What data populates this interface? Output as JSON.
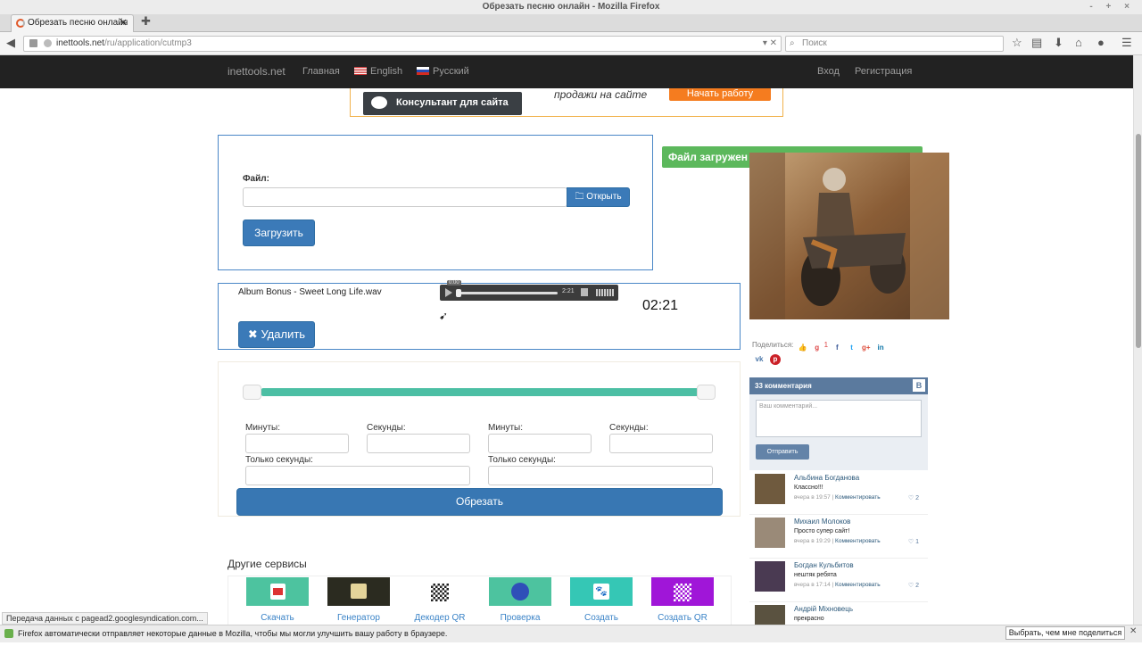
{
  "window": {
    "title": "Обрезать песню онлайн - Mozilla Firefox",
    "controls": "- + ×"
  },
  "tab": {
    "title": "Обрезать песню онлайн",
    "close": "✕",
    "new_tab": "✚"
  },
  "navbar": {
    "url_host": "inettools.net",
    "url_path": "/ru/application/cutmp3",
    "url_right": "▾ ✕",
    "search_placeholder": "Поиск"
  },
  "site_nav": {
    "brand": "inettools.net",
    "home": "Главная",
    "english": "English",
    "russian": "Русский",
    "login": "Вход",
    "register": "Регистрация"
  },
  "ad": {
    "consultant": "Консультант для сайта",
    "tagline": "продажи на сайте",
    "cta": "Начать работу"
  },
  "upload": {
    "file_label": "Файл:",
    "open_btn": "Открыть",
    "upload_btn": "Загрузить"
  },
  "track": {
    "name": "Album Bonus - Sweet Long Life.wav",
    "player_time": "2:21",
    "player_tip": "0:00",
    "duration": "02:21",
    "delete_btn": "Удалить"
  },
  "trim": {
    "start_min_label": "Минуты:",
    "start_sec_label": "Секунды:",
    "end_min_label": "Минуты:",
    "end_sec_label": "Секунды:",
    "start_only_sec": "Только секунды:",
    "end_only_sec": "Только секунды:",
    "cut_btn": "Обрезать"
  },
  "side": {
    "file_loaded": "Файл загружен",
    "share_label": "Поделиться:",
    "share_count": "1"
  },
  "vk": {
    "count": "33 комментария",
    "logo": "В",
    "placeholder": "Ваш комментарий...",
    "send": "Отправить",
    "comments": [
      {
        "name": "Альбина Богданова",
        "text": "Классно!!!",
        "time": "вчера в 19:57",
        "action": "Комментировать",
        "likes": "2"
      },
      {
        "name": "Михаил Молоков",
        "text": "Просто супер сайт!",
        "time": "вчера в 19:29",
        "action": "Комментировать",
        "likes": "1"
      },
      {
        "name": "Богдан Кульбитов",
        "text": "нештяк ребята",
        "time": "вчера в 17:14",
        "action": "Комментировать",
        "likes": "2"
      },
      {
        "name": "Андрій Міхновець",
        "text": "прекрасно",
        "time": "",
        "action": "",
        "likes": ""
      }
    ]
  },
  "other": {
    "title": "Другие сервисы",
    "items": [
      {
        "label": "Скачать",
        "color": "#4dc39f"
      },
      {
        "label": "Генератор",
        "color": "#2b2b20"
      },
      {
        "label": "Декодер QR",
        "color": "#ffffff"
      },
      {
        "label": "Проверка",
        "color": "#4dc39f"
      },
      {
        "label": "Создать",
        "color": "#35c7b5"
      },
      {
        "label": "Создать QR",
        "color": "#a016d8"
      }
    ]
  },
  "status": {
    "text": "Передача данных с pagead2.googlesyndication.com..."
  },
  "notification": {
    "text": "Firefox автоматически отправляет некоторые данные в Mozilla, чтобы мы могли улучшить вашу работу в браузере.",
    "button": "Выбрать, чем мне поделиться",
    "close": "✕"
  }
}
